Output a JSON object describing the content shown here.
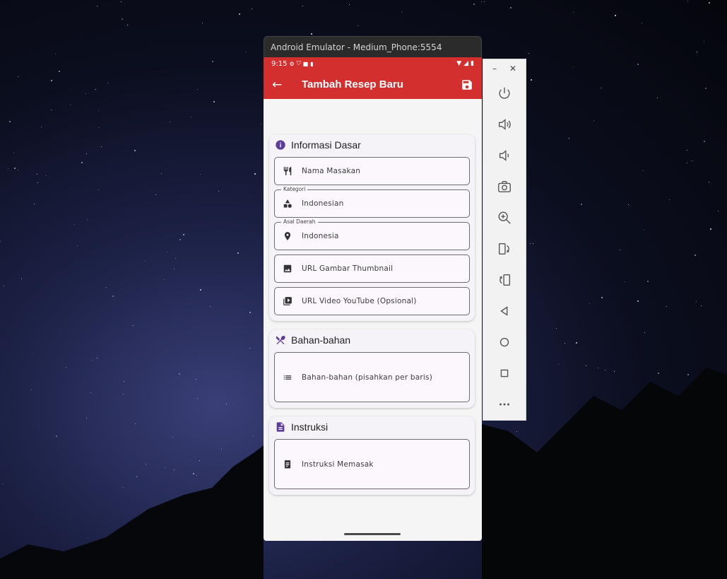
{
  "window": {
    "title": "Android Emulator - Medium_Phone:5554"
  },
  "status_bar": {
    "time": "9:15"
  },
  "appbar": {
    "title": "Tambah Resep Baru",
    "back_icon": "arrow-left-icon",
    "save_icon": "save-icon"
  },
  "sections": {
    "info": {
      "title": "Informasi Dasar",
      "icon": "info-icon",
      "fields": {
        "nama": {
          "placeholder": "Nama Masakan",
          "icon": "fork-knife-icon"
        },
        "kategori": {
          "label": "Kategori",
          "value": "Indonesian",
          "icon": "category-icon"
        },
        "asal": {
          "label": "Asal Daerah",
          "value": "Indonesia",
          "icon": "location-pin-icon"
        },
        "thumbnail": {
          "placeholder": "URL Gambar Thumbnail",
          "icon": "image-icon"
        },
        "video": {
          "placeholder": "URL Video YouTube (Opsional)",
          "icon": "video-library-icon"
        }
      }
    },
    "bahan": {
      "title": "Bahan-bahan",
      "icon": "dining-icon",
      "fields": {
        "bahan": {
          "placeholder": "Bahan-bahan (pisahkan per baris)",
          "icon": "list-icon"
        }
      }
    },
    "instruksi": {
      "title": "Instruksi",
      "icon": "document-icon",
      "fields": {
        "instruksi": {
          "placeholder": "Instruksi Memasak",
          "icon": "receipt-icon"
        }
      }
    }
  },
  "emulator_toolbar": {
    "window_controls": {
      "minimize": "–",
      "close": "✕"
    },
    "tools": [
      "power-icon",
      "volume-up-icon",
      "volume-down-icon",
      "camera-icon",
      "zoom-in-icon",
      "rotate-left-icon",
      "rotate-right-icon",
      "back-icon",
      "home-icon",
      "overview-icon",
      "more-icon"
    ]
  },
  "colors": {
    "primary": "#d32f2f",
    "accent_icon": "#5c3d99",
    "card_bg": "#f6f3f8",
    "field_bg": "#fcf7fd"
  }
}
